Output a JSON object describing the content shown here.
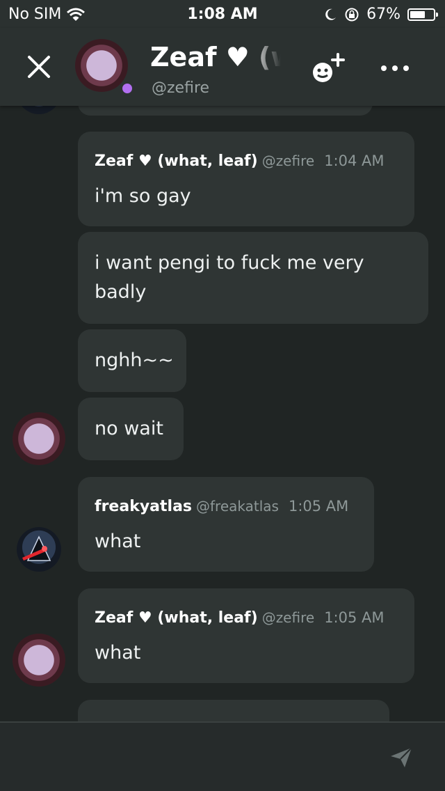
{
  "status_bar": {
    "carrier": "No SIM",
    "time": "1:08 AM",
    "battery_percent": "67%",
    "battery_level": 0.67
  },
  "header": {
    "title": "Zeaf ♥ (what, leaf)",
    "handle": "@zefire",
    "status_color": "#b26ff0"
  },
  "messages": [
    {
      "author": "Zeaf ♥ (what, leaf)",
      "handle": "@zefire",
      "time": "1:04 AM",
      "text": "i'm so gay"
    },
    {
      "text_lines": [
        "i want pengi to fuck me very",
        "badly"
      ]
    },
    {
      "text": "nghh~~"
    },
    {
      "text": "no wait"
    },
    {
      "author": "freakyatlas",
      "handle": "@freakatlas",
      "time": "1:05 AM",
      "text": "what"
    },
    {
      "author": "Zeaf ♥ (what, leaf)",
      "handle": "@zefire",
      "time": "1:05 AM",
      "text": "what"
    }
  ],
  "icons": {
    "close": "close-icon",
    "add_friend": "add-friend-icon",
    "more": "more-icon",
    "send": "send-icon"
  },
  "colors": {
    "background": "#202524",
    "bar": "#2b3130",
    "bubble": "#2f3534",
    "muted_text": "#8e9898"
  }
}
